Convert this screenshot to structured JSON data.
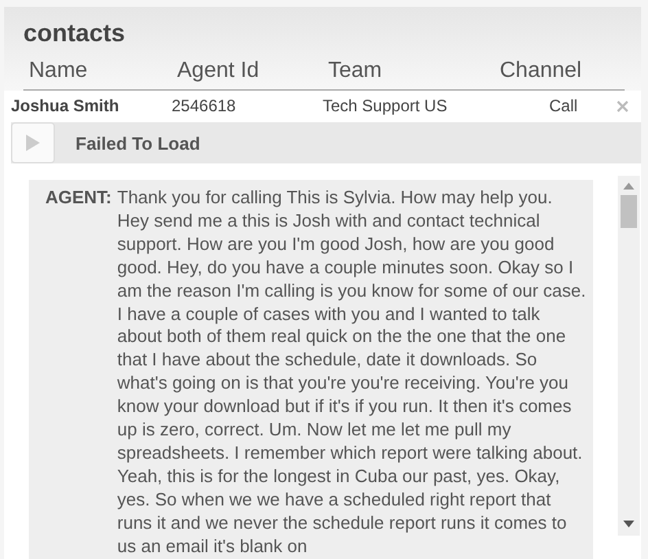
{
  "title": "contacts",
  "columns": [
    "Name",
    "Agent Id",
    "Team",
    "Channel"
  ],
  "row": {
    "name": "Joshua Smith",
    "agent_id": "2546618",
    "team": "Tech Support US",
    "channel": "Call"
  },
  "player": {
    "status": "Failed To Load"
  },
  "transcript": [
    {
      "speaker": "AGENT:",
      "text": "Thank you for calling This is Sylvia. How may help you. Hey send me a this is Josh with and contact technical support. How are you I'm good Josh, how are you good good. Hey, do you have a couple minutes soon. Okay so I am the reason I'm calling is you know for some of our case. I have a couple of cases with you and I wanted to talk about both of them real quick on the the one that the one that I have about the schedule, date it downloads. So what's going on is that you're you're receiving. You're you know your download but if it's if you run. It then it's comes up is zero, correct. Um. Now let me let me pull my spreadsheets. I remember which report were talking about. Yeah, this is for the longest in Cuba our past, yes. Okay, yes. So when we we have a scheduled right report that runs it and we never the schedule report runs it comes to us an email it's blank on"
    }
  ]
}
